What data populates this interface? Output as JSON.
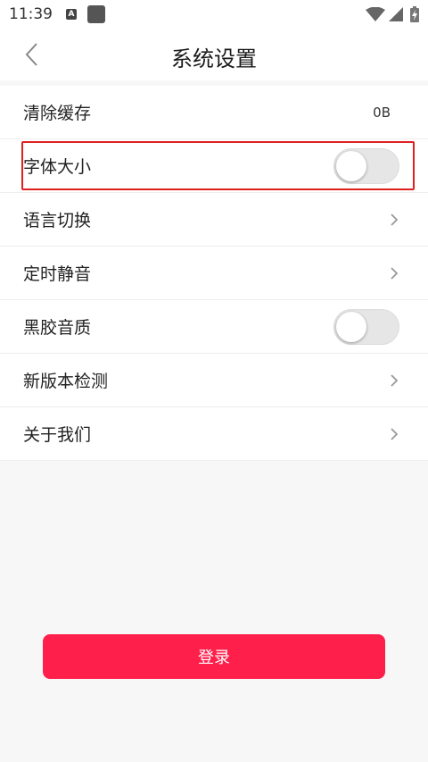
{
  "status_bar": {
    "time": "11:39",
    "a_badge": "A",
    "icons": [
      "a-notification-icon",
      "app-notification-icon",
      "wifi-icon",
      "signal-icon",
      "battery-icon"
    ]
  },
  "header": {
    "title": "系统设置",
    "back_icon": "chevron-left-icon"
  },
  "settings": {
    "items": [
      {
        "label": "清除缓存",
        "value": "0B"
      },
      {
        "label": "字体大小",
        "toggle": false
      },
      {
        "label": "语言切换",
        "chevron": true
      },
      {
        "label": "定时静音",
        "chevron": true
      },
      {
        "label": "黑胶音质",
        "toggle": false
      },
      {
        "label": "新版本检测",
        "chevron": true
      },
      {
        "label": "关于我们",
        "chevron": true
      }
    ]
  },
  "login": {
    "label": "登录"
  },
  "colors": {
    "accent": "#ff1f4b",
    "highlight": "#e02020",
    "background": "#f7f7f7"
  }
}
